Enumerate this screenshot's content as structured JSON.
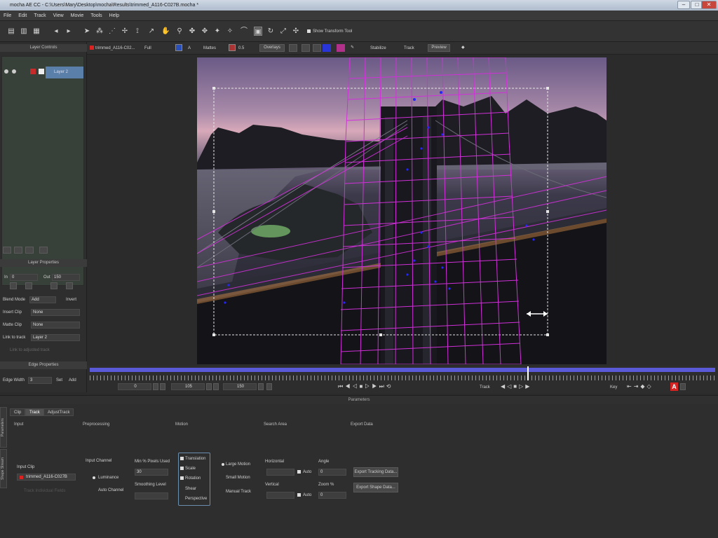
{
  "window": {
    "title": "mocha AE CC - C:\\Users\\Mary\\Desktop\\mocha\\Results\\trimmed_A116-C027B.mocha *",
    "controls": [
      "–",
      "□",
      "✕"
    ]
  },
  "menu": [
    "File",
    "Edit",
    "Track",
    "View",
    "Movie",
    "Tools",
    "Help"
  ],
  "toolbar": {
    "show_transform_tool": "Show Transform Tool"
  },
  "layer_controls": {
    "header": "Layer Controls",
    "layer_name": "Layer 2",
    "link_label": "lt"
  },
  "layer_properties": {
    "header": "Layer Properties",
    "in_label": "In",
    "in_value": "0",
    "out_label": "Out",
    "out_value": "150",
    "blend_mode_label": "Blend Mode",
    "blend_mode_value": "Add",
    "invert_label": "Invert",
    "insert_clip_label": "Insert Clip",
    "insert_clip_value": "None",
    "matte_clip_label": "Matte Clip",
    "matte_clip_value": "None",
    "link_to_track_label": "Link to track",
    "link_to_track_value": "Layer 2",
    "link_adjusted_label": "Link to adjusted track"
  },
  "edge_properties": {
    "header": "Edge Properties",
    "edge_width_label": "Edge Width",
    "edge_width_value": "3",
    "set_label": "Set",
    "add_label": "Add"
  },
  "viewer_bar": {
    "clip": "trimmed_A116-C02...",
    "zoom": "Full",
    "mattes": "Mattes",
    "value": "0.5",
    "overlays": "Overlays",
    "stabilize": "Stabilize",
    "track": "Track",
    "preview": "Preview"
  },
  "timeline": {
    "start": "0",
    "current": "105",
    "end": "150",
    "track_label": "Track",
    "key_label": "Key",
    "progress": 0.7
  },
  "params": {
    "header": "Parameters",
    "tabs": [
      "Clip",
      "Track",
      "AdjustTrack"
    ],
    "active_tab": "Track",
    "side_tabs": [
      "Parameters",
      "Shape Stream"
    ],
    "sections": {
      "input": "Input",
      "preprocessing": "Preprocessing",
      "motion": "Motion",
      "search_area": "Search Area",
      "export_data": "Export Data"
    },
    "input_clip_label": "Input Clip",
    "input_clip_value": "trimmed_A116-C027B",
    "track_individual": "Track Individual Fields",
    "input_channel_label": "Input Channel",
    "luminance": "Luminance",
    "auto_channel": "Auto Channel",
    "min_pixels_label": "Min % Pixels Used",
    "min_pixels_value": "30",
    "smoothing_label": "Smoothing Level",
    "motion_options": [
      "Translation",
      "Scale",
      "Rotation",
      "Shear",
      "Perspective"
    ],
    "tracking_modes": [
      "Large Motion",
      "Small Motion",
      "Manual Track"
    ],
    "horizontal_label": "Horizontal",
    "vertical_label": "Vertical",
    "auto_label": "Auto",
    "angle_label": "Angle",
    "angle_value": "0",
    "zoom_label": "Zoom %",
    "zoom_value": "0",
    "export_tracking": "Export Tracking Data...",
    "export_shape": "Export Shape Data..."
  },
  "colors": {
    "grid": "#d030d8",
    "points": "#2020ff",
    "panel": "#2e2e2e",
    "accent": "#5a5ad8"
  }
}
